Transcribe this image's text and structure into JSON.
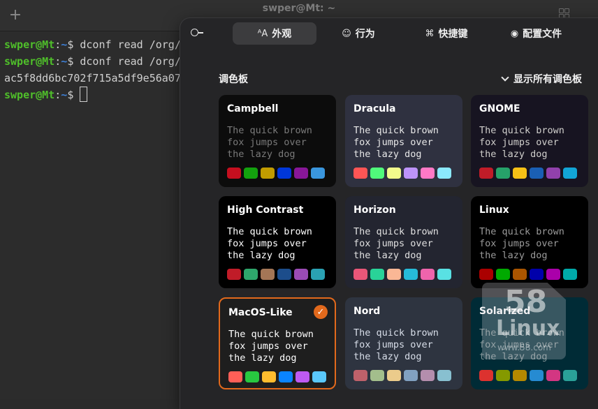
{
  "window": {
    "title": "swper@Mt: ~",
    "new_tab_glyph": "+"
  },
  "terminal": {
    "lines": [
      {
        "user": "swper@Mt",
        "sep": ":",
        "path": "~",
        "dollar": "$ ",
        "cmd": "dconf read /org/"
      },
      {
        "user": "swper@Mt",
        "sep": ":",
        "path": "~",
        "dollar": "$ ",
        "cmd": "dconf read /org/"
      },
      {
        "output": "ac5f8dd6bc702f715a5df9e56a07"
      },
      {
        "user": "swper@Mt",
        "sep": ":",
        "path": "~",
        "dollar": "$ "
      }
    ]
  },
  "prefs": {
    "tabs": [
      {
        "label": "外观",
        "icon": "appearance-icon",
        "glyph": "ᴬA",
        "active": true
      },
      {
        "label": "行为",
        "icon": "accessibility-icon",
        "glyph": "☺",
        "active": false
      },
      {
        "label": "快捷键",
        "icon": "command-key-icon",
        "glyph": "⌘",
        "active": false
      },
      {
        "label": "配置文件",
        "icon": "profile-icon",
        "glyph": "◉",
        "active": false
      }
    ],
    "section_title": "调色板",
    "show_all_label": "显示所有调色板",
    "sample_text": "The quick brown\nfox jumps over\nthe lazy dog",
    "palettes": [
      {
        "name": "Campbell",
        "bg": "#0c0c0c",
        "fg": "#cccccc",
        "name_color": "#ffffff",
        "text_color": "#7a7a7a",
        "swatches": [
          "#c50f1f",
          "#13a10e",
          "#c19c00",
          "#0037da",
          "#881798",
          "#3a96dd"
        ]
      },
      {
        "name": "Dracula",
        "bg": "#2f3140",
        "fg": "#f8f8f2",
        "name_color": "#ffffff",
        "text_color": "#e8e8e8",
        "swatches": [
          "#ff5555",
          "#50fa7b",
          "#f1fa8c",
          "#bd93f9",
          "#ff79c6",
          "#8be9fd"
        ]
      },
      {
        "name": "GNOME",
        "bg": "#171421",
        "fg": "#d0cfcc",
        "name_color": "#ffffff",
        "text_color": "#d0cfcc",
        "swatches": [
          "#c01c28",
          "#26a269",
          "#f6c016",
          "#1a5fb4",
          "#9141ac",
          "#12a5d6"
        ]
      },
      {
        "name": "High Contrast",
        "bg": "#000000",
        "fg": "#ffffff",
        "name_color": "#ffffff",
        "text_color": "#ffffff",
        "swatches": [
          "#c01c28",
          "#2ea66b",
          "#a47656",
          "#1c4d8b",
          "#9a4bb5",
          "#2aa1b3"
        ]
      },
      {
        "name": "Horizon",
        "bg": "#232530",
        "fg": "#e0e0e0",
        "name_color": "#ffffff",
        "text_color": "#e0e0e0",
        "swatches": [
          "#e95678",
          "#29d398",
          "#fab795",
          "#26bbd9",
          "#ee64ac",
          "#59e1e3"
        ]
      },
      {
        "name": "Linux",
        "bg": "#000000",
        "fg": "#aaaaaa",
        "name_color": "#ffffff",
        "text_color": "#9a9a9a",
        "swatches": [
          "#aa0000",
          "#00aa00",
          "#aa5500",
          "#0000aa",
          "#aa00aa",
          "#00aaaa"
        ]
      },
      {
        "name": "MacOS-Like",
        "bg": "#1e1e1e",
        "fg": "#ffffff",
        "name_color": "#ffffff",
        "text_color": "#ffffff",
        "selected": true,
        "swatches": [
          "#ff5f57",
          "#28c840",
          "#febc2e",
          "#0a84ff",
          "#bf5af2",
          "#5ac8fa"
        ]
      },
      {
        "name": "Nord",
        "bg": "#2e3440",
        "fg": "#d8dee9",
        "name_color": "#ffffff",
        "text_color": "#d8dee9",
        "swatches": [
          "#bf616a",
          "#a3be8c",
          "#ebcb8b",
          "#81a1c1",
          "#b48ead",
          "#88c0d0"
        ]
      },
      {
        "name": "Solarized",
        "bg": "#002b36",
        "fg": "#839496",
        "name_color": "#ffffff",
        "text_color": "#839496",
        "swatches": [
          "#dc322f",
          "#859900",
          "#b58900",
          "#268bd2",
          "#d33682",
          "#2aa198"
        ]
      }
    ]
  },
  "watermark": {
    "number": "58",
    "text": "Linux",
    "url": "www.58.com"
  },
  "colors": {
    "accent": "#e2691c",
    "dialog_bg": "#252527",
    "prompt_user": "#4fbf2a",
    "prompt_path": "#3d7fd6"
  }
}
